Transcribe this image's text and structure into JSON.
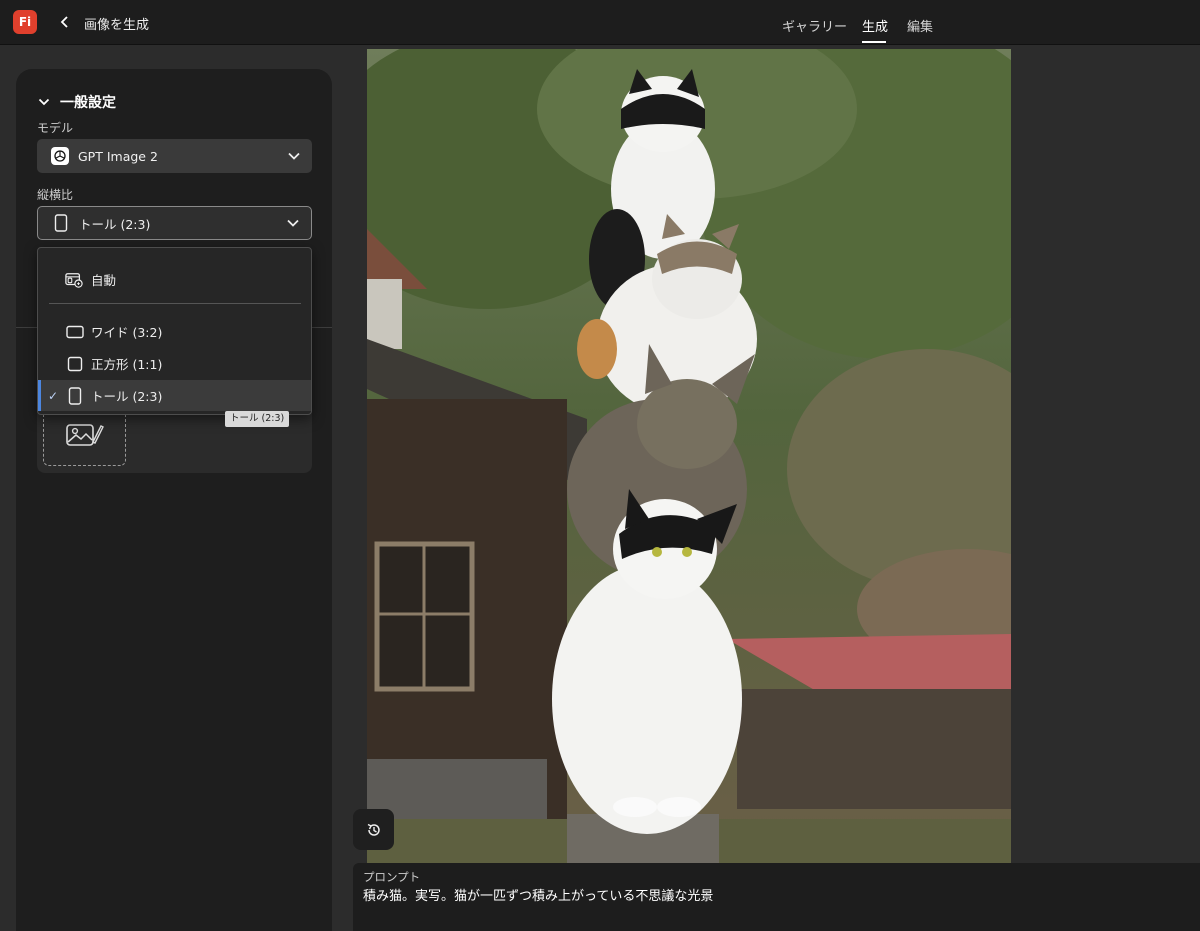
{
  "app": {
    "logo_text": "Fi",
    "page_title": "画像を生成"
  },
  "nav": {
    "tabs": [
      {
        "label": "ギャラリー"
      },
      {
        "label": "生成"
      },
      {
        "label": "編集"
      }
    ],
    "active": "生成"
  },
  "settings": {
    "section_title": "一般設定",
    "model_label": "モデル",
    "model_value": "GPT Image 2",
    "ratio_label": "縦横比",
    "ratio_value": "トール (2:3)"
  },
  "ratio_dropdown": {
    "options": [
      {
        "label": "自動",
        "icon": "auto-ratio-icon"
      },
      {
        "label": "ワイド (3:2)",
        "icon": "landscape-rect-icon"
      },
      {
        "label": "正方形 (1:1)",
        "icon": "square-icon"
      },
      {
        "label": "トール (2:3)",
        "icon": "portrait-rect-icon",
        "selected": true
      }
    ],
    "check_glyph": "✓",
    "tooltip": "トール (2:3)"
  },
  "prompt": {
    "label": "プロンプト",
    "text": "積み猫。実写。猫が一匹ずつ積み上がっている不思議な光景"
  },
  "colors": {
    "accent": "#4c86e0",
    "logo": "#e0402d",
    "panel": "#1e1e1e",
    "topbar": "#1d1d1d"
  }
}
